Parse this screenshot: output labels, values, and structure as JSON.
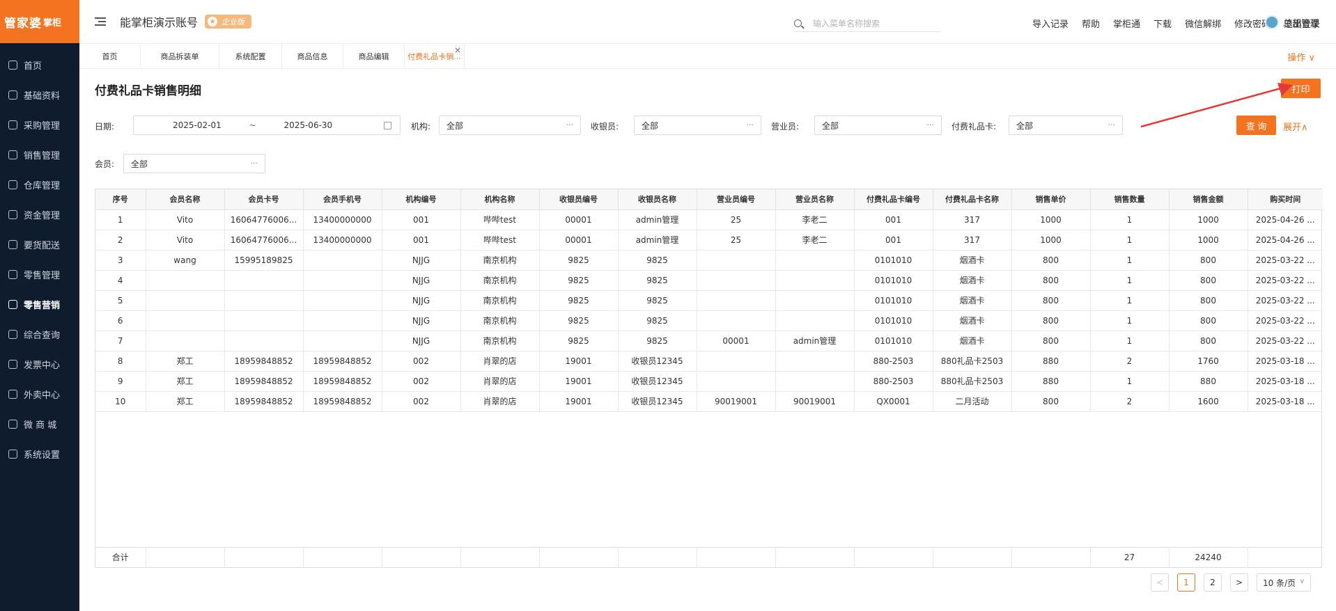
{
  "brand": {
    "name": "管家婆",
    "product": "掌柜"
  },
  "sidebar": {
    "items": [
      {
        "label": "首页",
        "icon": "globe-icon"
      },
      {
        "label": "基础资料",
        "icon": "home-icon"
      },
      {
        "label": "采购管理",
        "icon": "cart-icon"
      },
      {
        "label": "销售管理",
        "icon": "sales-icon"
      },
      {
        "label": "仓库管理",
        "icon": "warehouse-icon"
      },
      {
        "label": "资金管理",
        "icon": "money-icon"
      },
      {
        "label": "要货配送",
        "icon": "delivery-icon"
      },
      {
        "label": "零售管理",
        "icon": "chart-icon"
      },
      {
        "label": "零售营销",
        "icon": "gift-icon"
      },
      {
        "label": "综合查询",
        "icon": "bar-chart-icon"
      },
      {
        "label": "发票中心",
        "icon": "invoice-icon"
      },
      {
        "label": "外卖中心",
        "icon": "takeout-icon"
      },
      {
        "label": "微 商 城",
        "icon": "shop-icon"
      },
      {
        "label": "系统设置",
        "icon": "gear-icon"
      }
    ],
    "active_index": 8
  },
  "header": {
    "account_title": "能掌柜演示账号",
    "badge": "企业版",
    "search_placeholder": "输入菜单名称搜索",
    "links": [
      "导入记录",
      "帮助",
      "掌柜通",
      "下载",
      "微信解绑",
      "修改密码",
      "退出登录"
    ],
    "user": "总部管理"
  },
  "tabs": {
    "items": [
      "首页",
      "商品拆装单",
      "系统配置",
      "商品信息",
      "商品编辑",
      "付费礼品卡销..."
    ],
    "active_index": 5,
    "ops_label": "操作 ∨"
  },
  "page": {
    "title": "付费礼品卡销售明细",
    "print_label": "打印"
  },
  "filters": {
    "date_label": "日期:",
    "date_start": "2025-02-01",
    "date_sep": "~",
    "date_end": "2025-06-30",
    "org_label": "机构:",
    "org_value": "全部",
    "cashier_label": "收银员:",
    "cashier_value": "全部",
    "salesman_label": "营业员:",
    "salesman_value": "全部",
    "card_label": "付费礼品卡:",
    "card_value": "全部",
    "member_label": "会员:",
    "member_value": "全部",
    "query_label": "查 询",
    "expand_label": "展开∧"
  },
  "table": {
    "columns": [
      "序号",
      "会员名称",
      "会员卡号",
      "会员手机号",
      "机构编号",
      "机构名称",
      "收银员编号",
      "收银员名称",
      "营业员编号",
      "营业员名称",
      "付费礼品卡编号",
      "付费礼品卡名称",
      "销售单价",
      "销售数量",
      "销售金额",
      "购买时间"
    ],
    "rows": [
      [
        "1",
        "Vito",
        "16064776006...",
        "13400000000",
        "001",
        "哔哔test",
        "00001",
        "admin管理",
        "25",
        "李老二",
        "001",
        "317",
        "1000",
        "1",
        "1000",
        "2025-04-26 ..."
      ],
      [
        "2",
        "Vito",
        "16064776006...",
        "13400000000",
        "001",
        "哔哔test",
        "00001",
        "admin管理",
        "25",
        "李老二",
        "001",
        "317",
        "1000",
        "1",
        "1000",
        "2025-04-26 ..."
      ],
      [
        "3",
        "wang",
        "15995189825",
        "",
        "NJJG",
        "南京机构",
        "9825",
        "9825",
        "",
        "",
        "0101010",
        "烟酒卡",
        "800",
        "1",
        "800",
        "2025-03-22 ..."
      ],
      [
        "4",
        "",
        "",
        "",
        "NJJG",
        "南京机构",
        "9825",
        "9825",
        "",
        "",
        "0101010",
        "烟酒卡",
        "800",
        "1",
        "800",
        "2025-03-22 ..."
      ],
      [
        "5",
        "",
        "",
        "",
        "NJJG",
        "南京机构",
        "9825",
        "9825",
        "",
        "",
        "0101010",
        "烟酒卡",
        "800",
        "1",
        "800",
        "2025-03-22 ..."
      ],
      [
        "6",
        "",
        "",
        "",
        "NJJG",
        "南京机构",
        "9825",
        "9825",
        "",
        "",
        "0101010",
        "烟酒卡",
        "800",
        "1",
        "800",
        "2025-03-22 ..."
      ],
      [
        "7",
        "",
        "",
        "",
        "NJJG",
        "南京机构",
        "9825",
        "9825",
        "00001",
        "admin管理",
        "0101010",
        "烟酒卡",
        "800",
        "1",
        "800",
        "2025-03-22 ..."
      ],
      [
        "8",
        "郑工",
        "18959848852",
        "18959848852",
        "002",
        "肖翠的店",
        "19001",
        "收银员12345",
        "",
        "",
        "880-2503",
        "880礼品卡2503",
        "880",
        "2",
        "1760",
        "2025-03-18 ..."
      ],
      [
        "9",
        "郑工",
        "18959848852",
        "18959848852",
        "002",
        "肖翠的店",
        "19001",
        "收银员12345",
        "",
        "",
        "880-2503",
        "880礼品卡2503",
        "880",
        "1",
        "880",
        "2025-03-18 ..."
      ],
      [
        "10",
        "郑工",
        "18959848852",
        "18959848852",
        "002",
        "肖翠的店",
        "19001",
        "收银员12345",
        "90019001",
        "90019001",
        "QX0001",
        "二月活动",
        "800",
        "2",
        "1600",
        "2025-03-18 ..."
      ]
    ],
    "footer": [
      "合计",
      "",
      "",
      "",
      "",
      "",
      "",
      "",
      "",
      "",
      "",
      "",
      "",
      "27",
      "24240",
      ""
    ]
  },
  "pagination": {
    "prev": "<",
    "pages": [
      "1",
      "2"
    ],
    "current": "1",
    "next": ">",
    "page_size": "10 条/页"
  },
  "colors": {
    "accent": "#f47320",
    "sidebar_bg": "#0f1c2e"
  }
}
